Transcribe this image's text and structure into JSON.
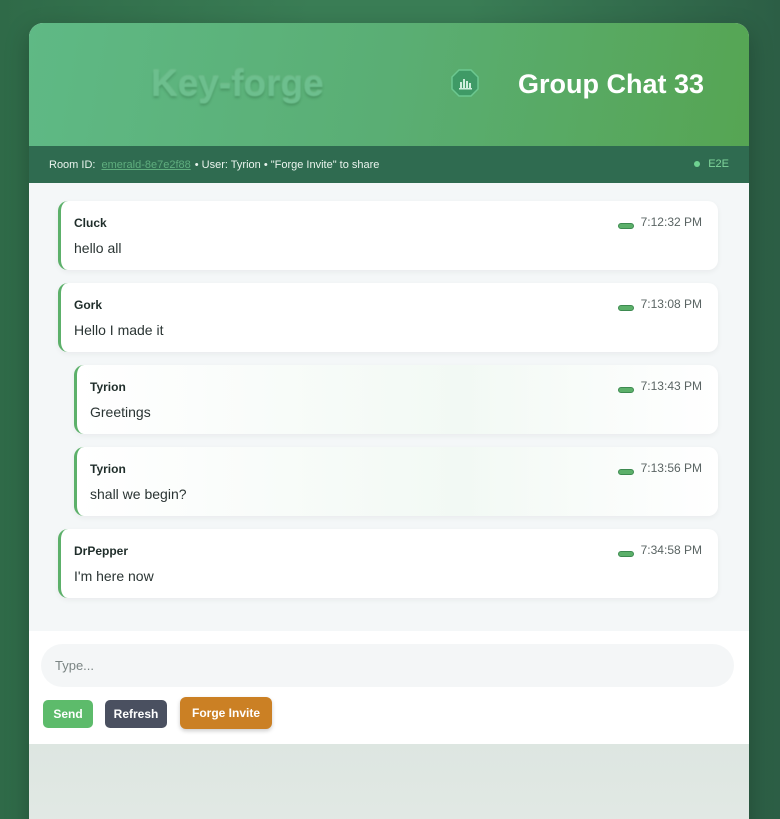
{
  "header": {
    "logo_text": "Key-forge",
    "title": "Group Chat 33",
    "icon": "chart-badge-icon"
  },
  "infobar": {
    "room_label": "Room ID:",
    "room_id": "emerald-8e7e2f88",
    "suffix": "• User: Tyrion • \"Forge Invite\" to share",
    "status": "E2E"
  },
  "messages": [
    {
      "sender": "Cluck",
      "text": "hello all",
      "time": "7:12:32 PM",
      "self": false
    },
    {
      "sender": "Gork",
      "text": "Hello I made it",
      "time": "7:13:08 PM",
      "self": false
    },
    {
      "sender": "Tyrion",
      "text": "Greetings",
      "time": "7:13:43 PM",
      "self": true
    },
    {
      "sender": "Tyrion",
      "text": "shall we begin?",
      "time": "7:13:56 PM",
      "self": true
    },
    {
      "sender": "DrPepper",
      "text": "I'm here now",
      "time": "7:34:58 PM",
      "self": false
    }
  ],
  "composer": {
    "placeholder": "Type...",
    "send_label": "Send",
    "refresh_label": "Refresh",
    "forge_label": "Forge Invite"
  },
  "colors": {
    "accent": "#5cb06a",
    "header_bar": "#2f6b50",
    "forge_button": "#cb8024",
    "refresh_button": "#4a5060"
  }
}
